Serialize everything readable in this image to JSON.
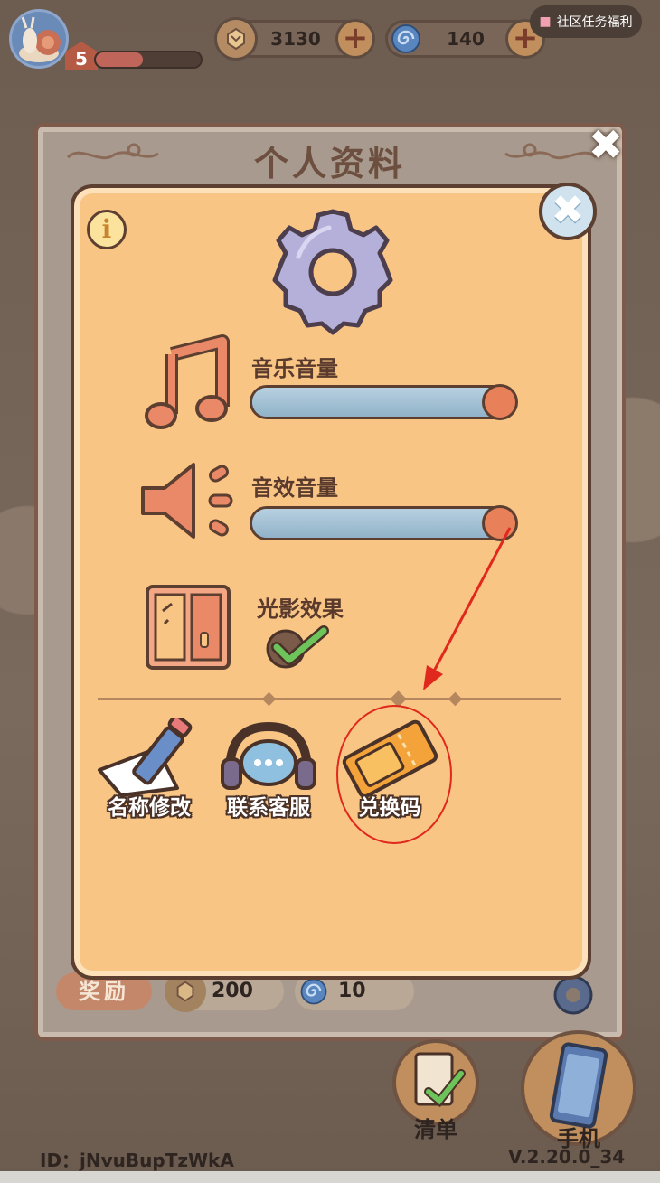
{
  "hud": {
    "level": "5",
    "xp_fraction": 0.45,
    "coins": "3130",
    "gems": "140",
    "community_label": "社区任务福利"
  },
  "outer": {
    "title": "个人资料",
    "reward_label": "奖励",
    "reward_coins": "200",
    "reward_gems": "10"
  },
  "settings": {
    "music_label": "音乐音量",
    "music_level": 1.0,
    "sfx_label": "音效音量",
    "sfx_level": 1.0,
    "lighting_label": "光影效果",
    "lighting_enabled": true
  },
  "actions": {
    "rename": "名称修改",
    "support": "联系客服",
    "redeem": "兑换码"
  },
  "footer": {
    "id_text": "ID：jNvuBupTzWkA",
    "version": "V.2.20.0_34",
    "list_label": "清单",
    "phone_label": "手机"
  },
  "colors": {
    "dialog_bg": "#f8c585",
    "annotation_red": "#e0281c",
    "knob": "#e8805a",
    "slider_track": "#8fb3cc"
  }
}
